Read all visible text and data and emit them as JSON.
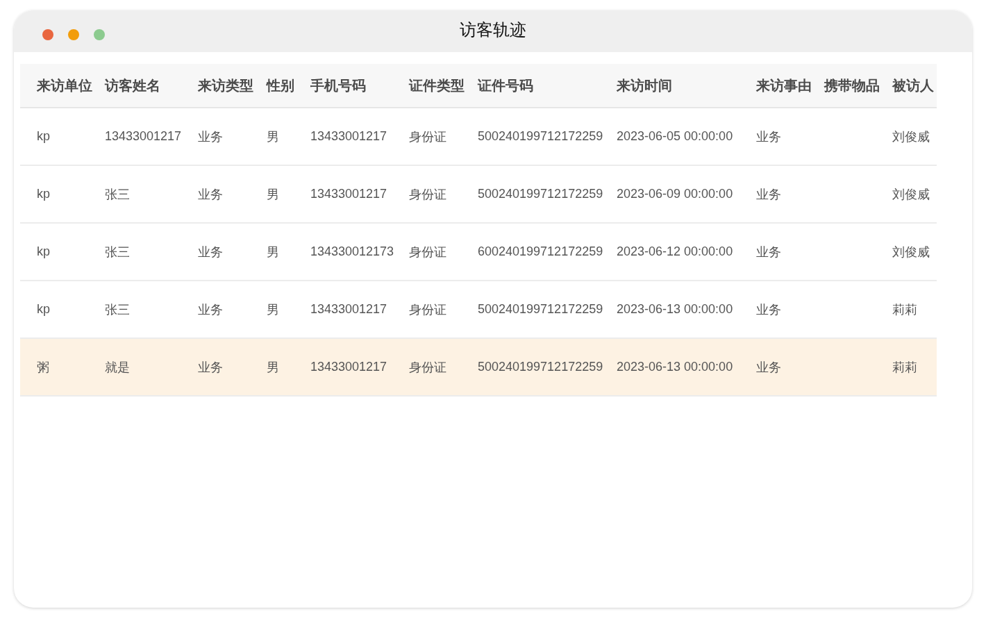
{
  "window": {
    "title": "访客轨迹"
  },
  "table": {
    "columns": [
      "来访单位",
      "访客姓名",
      "来访类型",
      "性别",
      "手机号码",
      "证件类型",
      "证件号码",
      "来访时间",
      "来访事由",
      "携带物品",
      "被访人"
    ],
    "rows": [
      {
        "selected": false,
        "cells": [
          "kp",
          "13433001217",
          "业务",
          "男",
          "13433001217",
          "身份证",
          "500240199712172259",
          "2023-06-05 00:00:00",
          "业务",
          null,
          "刘俊威"
        ]
      },
      {
        "selected": false,
        "cells": [
          "kp",
          "张三",
          "业务",
          "男",
          "13433001217",
          "身份证",
          "500240199712172259",
          "2023-06-09 00:00:00",
          "业务",
          null,
          "刘俊威"
        ]
      },
      {
        "selected": false,
        "cells": [
          "kp",
          "张三",
          "业务",
          "男",
          "134330012173",
          "身份证",
          "600240199712172259",
          "2023-06-12 00:00:00",
          "业务",
          null,
          "刘俊威"
        ]
      },
      {
        "selected": false,
        "cells": [
          "kp",
          "张三",
          "业务",
          "男",
          "13433001217",
          "身份证",
          "500240199712172259",
          "2023-06-13 00:00:00",
          "业务",
          null,
          "莉莉"
        ]
      },
      {
        "selected": true,
        "cells": [
          "粥",
          "就是",
          "业务",
          "男",
          "13433001217",
          "身份证",
          "500240199712172259",
          "2023-06-13 00:00:00",
          "业务",
          null,
          "莉莉"
        ]
      }
    ]
  }
}
